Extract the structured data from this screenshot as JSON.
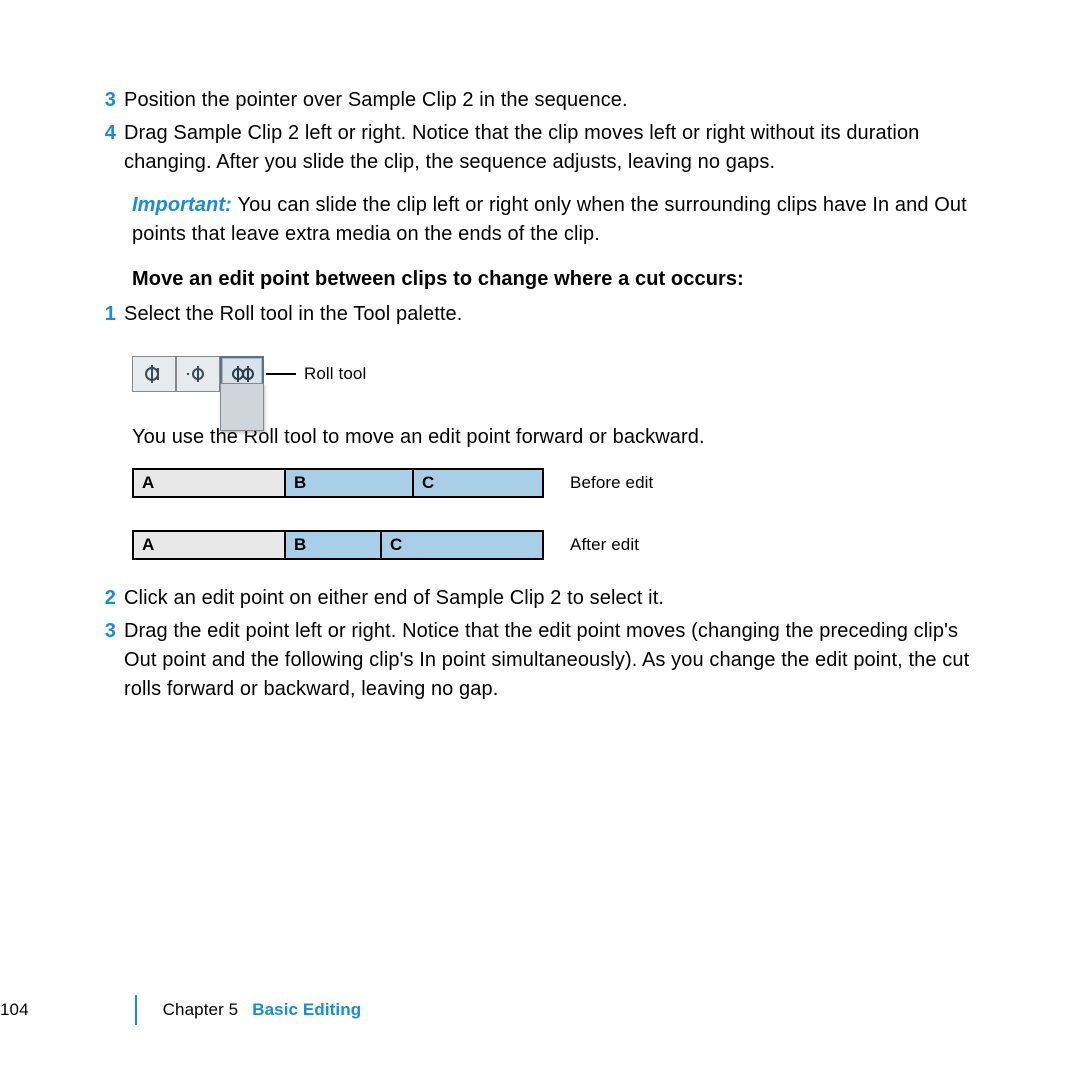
{
  "steps_top": [
    {
      "num": "3",
      "text": "Position the pointer over Sample Clip 2 in the sequence."
    },
    {
      "num": "4",
      "text": "Drag Sample Clip 2 left or right. Notice that the clip moves left or right without its duration changing. After you slide the clip, the sequence adjusts, leaving no gaps."
    }
  ],
  "important": {
    "lead": "Important:  ",
    "text": "You can slide the clip left or right only when the surrounding clips have In and Out points that leave extra media on the ends of the clip."
  },
  "subhead": "Move an edit point between clips to change where a cut occurs:",
  "step1": {
    "num": "1",
    "text": "Select the Roll tool in the Tool palette."
  },
  "tool_label": "Roll tool",
  "roll_desc": "You use the Roll tool to move an edit point forward or backward.",
  "bars": {
    "before": {
      "segs": [
        "A",
        "B",
        "C"
      ],
      "widths": [
        152,
        128,
        128
      ],
      "caption": "Before edit"
    },
    "after": {
      "segs": [
        "A",
        "B",
        "C"
      ],
      "widths": [
        152,
        96,
        160
      ],
      "caption": "After edit"
    }
  },
  "steps_bottom": [
    {
      "num": "2",
      "text": "Click an edit point on either end of Sample Clip 2 to select it."
    },
    {
      "num": "3",
      "text": "Drag the edit point left or right. Notice that the edit point moves (changing the preceding clip's Out point and the following clip's In point simultaneously). As you change the edit point, the cut rolls forward or backward, leaving no gap."
    }
  ],
  "footer": {
    "page": "104",
    "chapter": "Chapter 5",
    "title": "Basic Editing"
  }
}
